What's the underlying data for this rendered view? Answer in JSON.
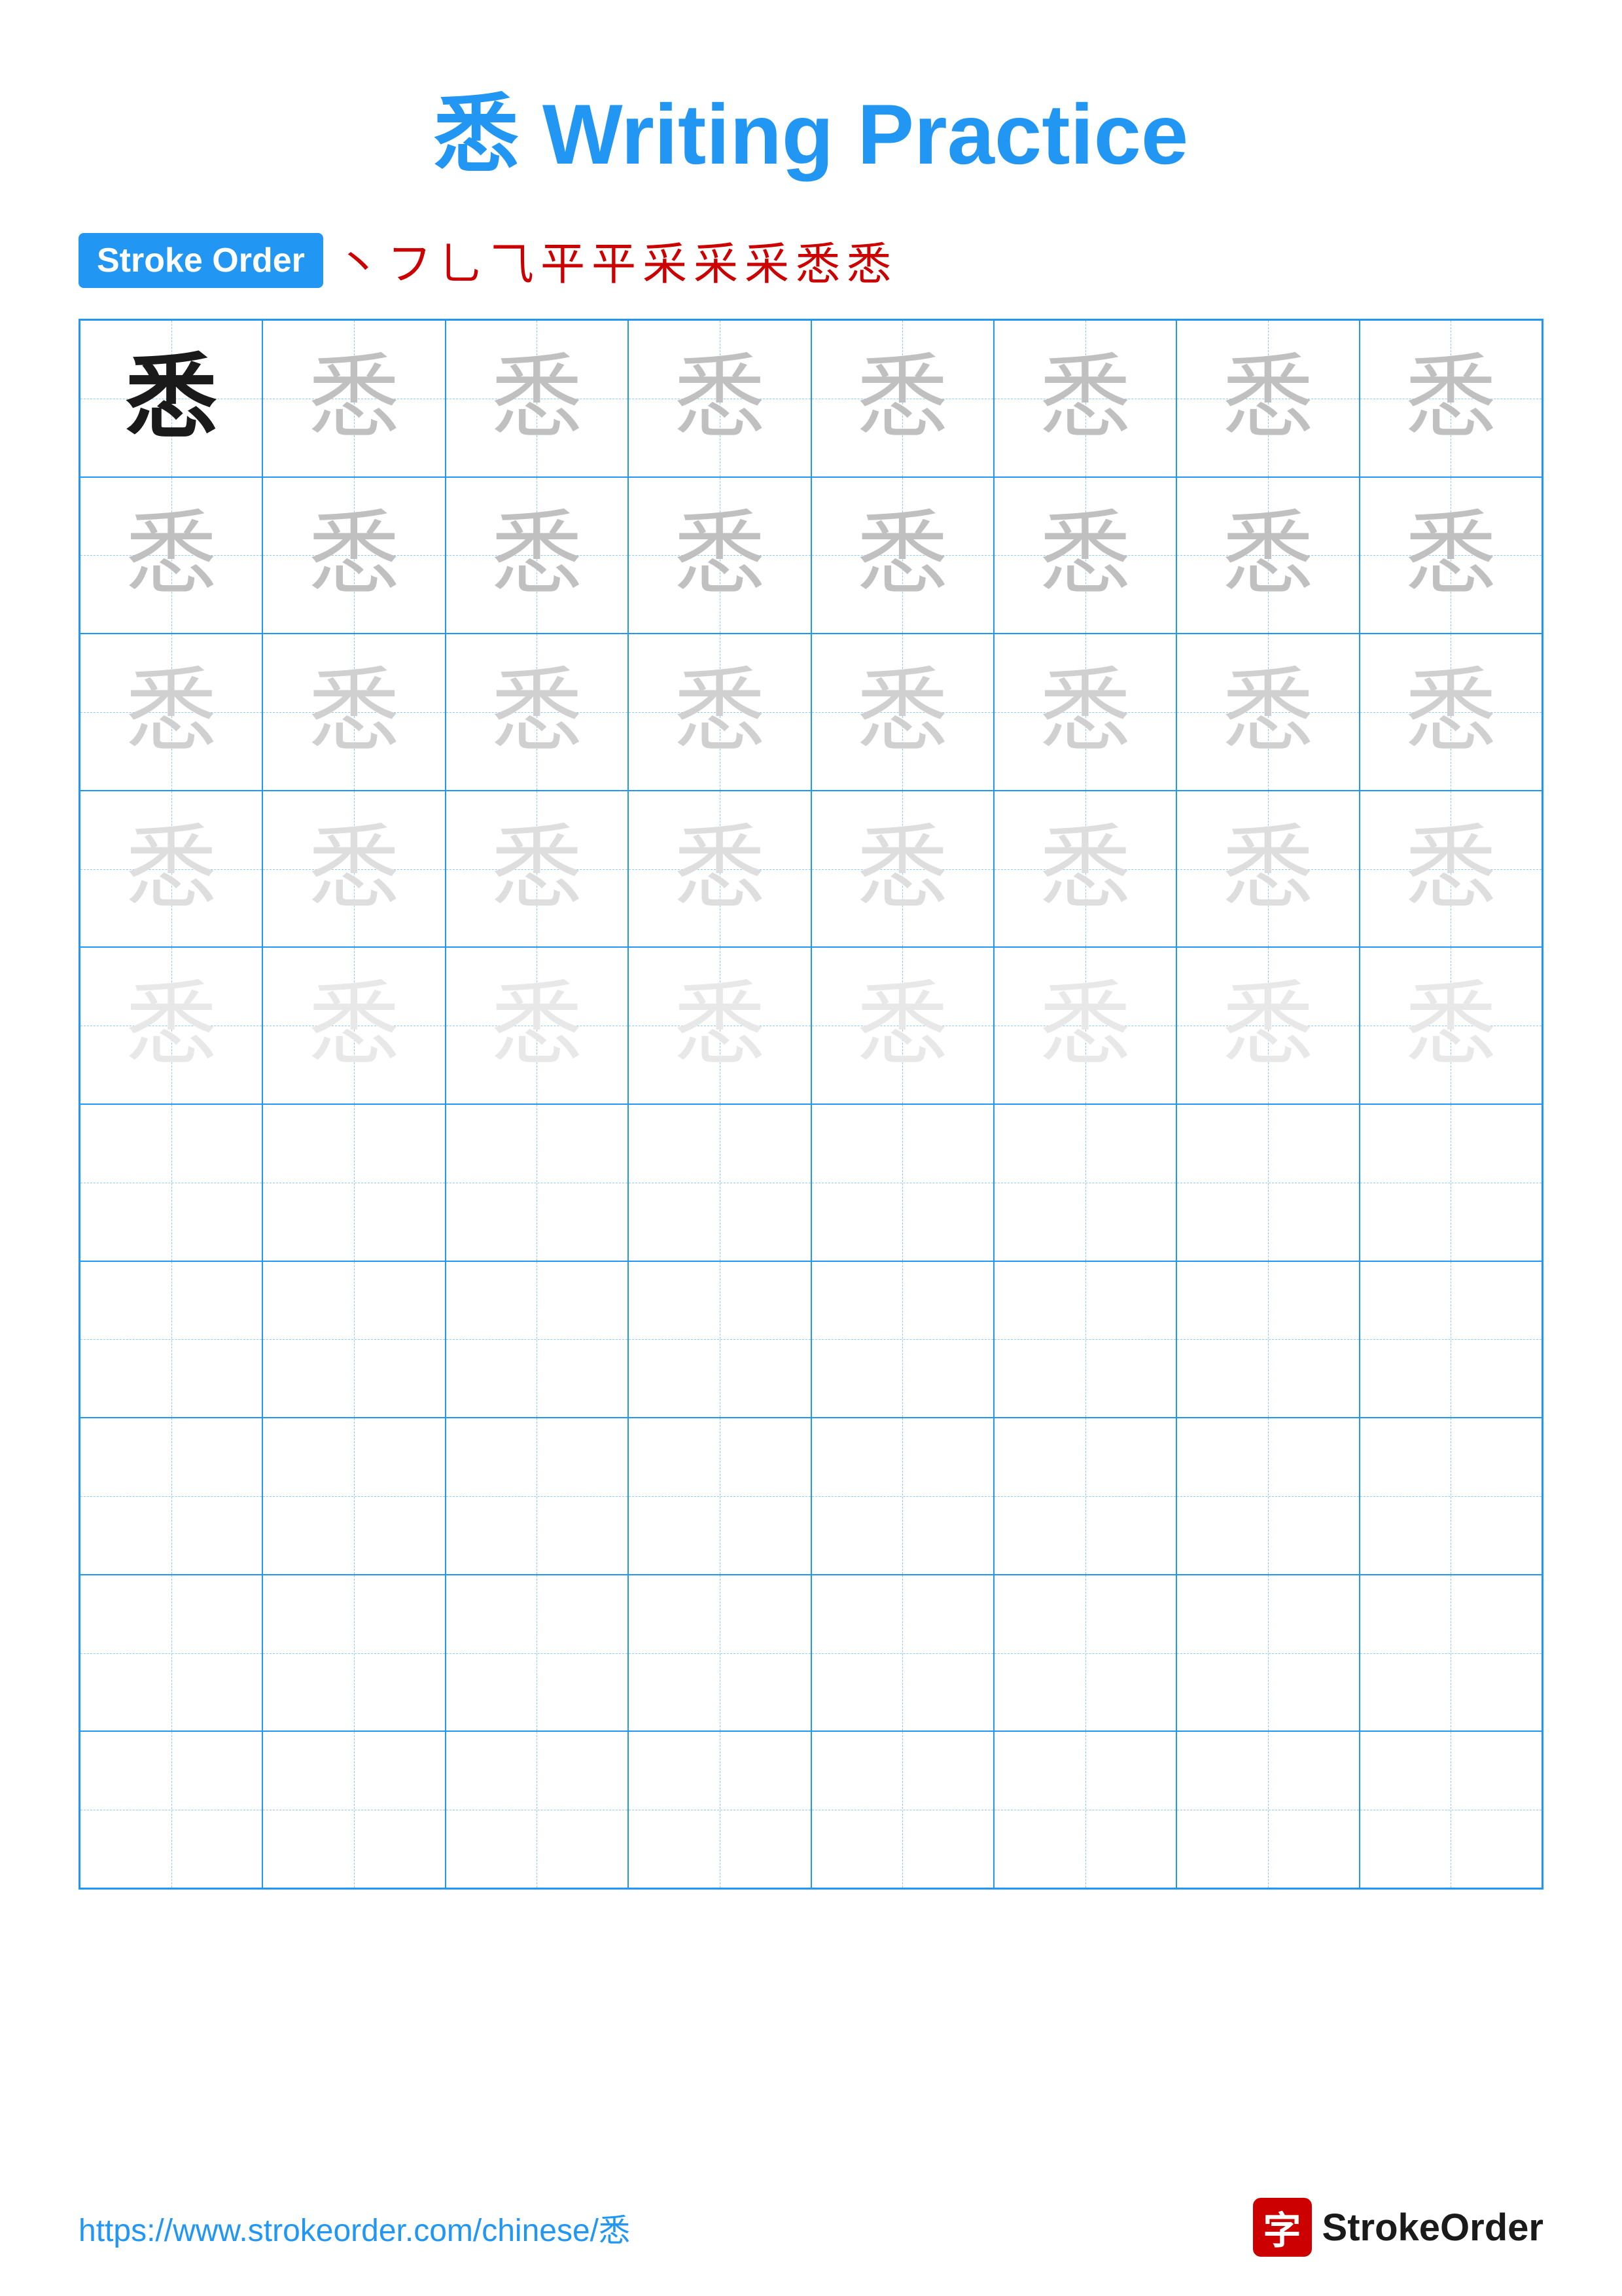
{
  "title": {
    "char": "悉",
    "text": " Writing Practice"
  },
  "stroke_order": {
    "badge_label": "Stroke Order",
    "strokes": [
      "丶",
      "フ",
      "⺃",
      "⺄",
      "平",
      "平",
      "采",
      "采",
      "采",
      "悉",
      "悉"
    ]
  },
  "grid": {
    "cols": 8,
    "rows": 10,
    "char": "悉",
    "filled_rows": 5,
    "empty_rows": 5
  },
  "footer": {
    "url": "https://www.strokeorder.com/chinese/悉",
    "logo_icon": "字",
    "logo_text": "StrokeOrder"
  }
}
